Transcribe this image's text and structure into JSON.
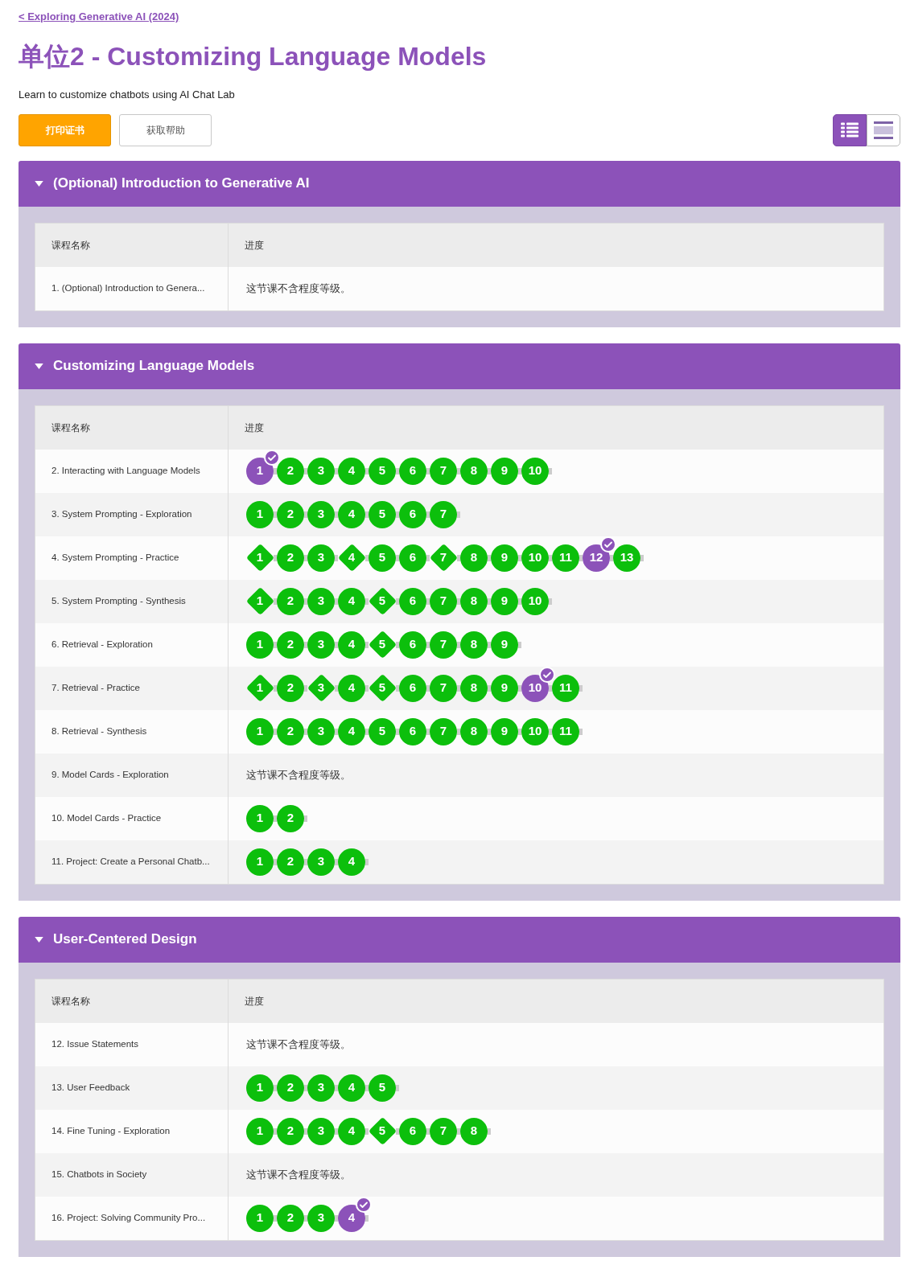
{
  "back_link": "< Exploring Generative AI (2024)",
  "title": "单位2 - Customizing Language Models",
  "description": "Learn to customize chatbots using AI Chat Lab",
  "buttons": [
    {
      "label": "打印证书",
      "kind": "primary"
    },
    {
      "label": "获取帮助",
      "kind": "secondary"
    }
  ],
  "view_toggle": [
    {
      "kind": "detail",
      "selected": true
    },
    {
      "kind": "summary",
      "selected": false
    }
  ],
  "sections": [
    {
      "title": "(Optional) Introduction to Generative AI",
      "expanded": true,
      "columns": [
        "课程名称",
        "进度"
      ],
      "rows": [
        {
          "name": "1. (Optional) Introduction to Genera...",
          "note": "这节课不含程度等级。"
        }
      ]
    },
    {
      "title": "Customizing Language Models",
      "expanded": true,
      "columns": [
        "课程名称",
        "进度"
      ],
      "rows": [
        {
          "name": "2. Interacting with Language Models",
          "levels": [
            {
              "label": "1",
              "kind": "circle",
              "selected": true
            },
            {
              "label": "2",
              "kind": "circle",
              "selected": false
            },
            {
              "label": "3",
              "kind": "circle",
              "selected": false
            },
            {
              "label": "4",
              "kind": "circle",
              "selected": false
            },
            {
              "label": "5",
              "kind": "circle",
              "selected": false
            },
            {
              "label": "6",
              "kind": "circle",
              "selected": false
            },
            {
              "label": "7",
              "kind": "circle",
              "selected": false
            },
            {
              "label": "8",
              "kind": "circle",
              "selected": false
            },
            {
              "label": "9",
              "kind": "circle",
              "selected": false
            },
            {
              "label": "10",
              "kind": "circle",
              "selected": false
            }
          ]
        },
        {
          "name": "3. System Prompting - Exploration",
          "levels": [
            {
              "label": "1",
              "kind": "circle",
              "selected": false
            },
            {
              "label": "2",
              "kind": "circle",
              "selected": false
            },
            {
              "label": "3",
              "kind": "circle",
              "selected": false
            },
            {
              "label": "4",
              "kind": "circle",
              "selected": false
            },
            {
              "label": "5",
              "kind": "circle",
              "selected": false
            },
            {
              "label": "6",
              "kind": "circle",
              "selected": false
            },
            {
              "label": "7",
              "kind": "circle",
              "selected": false
            }
          ]
        },
        {
          "name": "4. System Prompting - Practice",
          "levels": [
            {
              "label": "1",
              "kind": "diamond",
              "selected": false
            },
            {
              "label": "2",
              "kind": "circle",
              "selected": false
            },
            {
              "label": "3",
              "kind": "circle",
              "selected": false
            },
            {
              "label": "4",
              "kind": "diamond",
              "selected": false
            },
            {
              "label": "5",
              "kind": "circle",
              "selected": false
            },
            {
              "label": "6",
              "kind": "circle",
              "selected": false
            },
            {
              "label": "7",
              "kind": "diamond",
              "selected": false
            },
            {
              "label": "8",
              "kind": "circle",
              "selected": false
            },
            {
              "label": "9",
              "kind": "circle",
              "selected": false
            },
            {
              "label": "10",
              "kind": "circle",
              "selected": false
            },
            {
              "label": "11",
              "kind": "circle",
              "selected": false
            },
            {
              "label": "12",
              "kind": "circle",
              "selected": true
            },
            {
              "label": "13",
              "kind": "circle",
              "selected": false
            }
          ]
        },
        {
          "name": "5. System Prompting - Synthesis",
          "levels": [
            {
              "label": "1",
              "kind": "diamond",
              "selected": false
            },
            {
              "label": "2",
              "kind": "circle",
              "selected": false
            },
            {
              "label": "3",
              "kind": "circle",
              "selected": false
            },
            {
              "label": "4",
              "kind": "circle",
              "selected": false
            },
            {
              "label": "5",
              "kind": "diamond",
              "selected": false
            },
            {
              "label": "6",
              "kind": "circle",
              "selected": false
            },
            {
              "label": "7",
              "kind": "circle",
              "selected": false
            },
            {
              "label": "8",
              "kind": "circle",
              "selected": false
            },
            {
              "label": "9",
              "kind": "circle",
              "selected": false
            },
            {
              "label": "10",
              "kind": "circle",
              "selected": false
            }
          ]
        },
        {
          "name": "6. Retrieval - Exploration",
          "levels": [
            {
              "label": "1",
              "kind": "circle",
              "selected": false
            },
            {
              "label": "2",
              "kind": "circle",
              "selected": false
            },
            {
              "label": "3",
              "kind": "circle",
              "selected": false
            },
            {
              "label": "4",
              "kind": "circle",
              "selected": false
            },
            {
              "label": "5",
              "kind": "diamond",
              "selected": false
            },
            {
              "label": "6",
              "kind": "circle",
              "selected": false
            },
            {
              "label": "7",
              "kind": "circle",
              "selected": false
            },
            {
              "label": "8",
              "kind": "circle",
              "selected": false
            },
            {
              "label": "9",
              "kind": "circle",
              "selected": false
            }
          ]
        },
        {
          "name": "7. Retrieval - Practice",
          "levels": [
            {
              "label": "1",
              "kind": "diamond",
              "selected": false
            },
            {
              "label": "2",
              "kind": "circle",
              "selected": false
            },
            {
              "label": "3",
              "kind": "diamond",
              "selected": false
            },
            {
              "label": "4",
              "kind": "circle",
              "selected": false
            },
            {
              "label": "5",
              "kind": "diamond",
              "selected": false
            },
            {
              "label": "6",
              "kind": "circle",
              "selected": false
            },
            {
              "label": "7",
              "kind": "circle",
              "selected": false
            },
            {
              "label": "8",
              "kind": "circle",
              "selected": false
            },
            {
              "label": "9",
              "kind": "circle",
              "selected": false
            },
            {
              "label": "10",
              "kind": "circle",
              "selected": true
            },
            {
              "label": "11",
              "kind": "circle",
              "selected": false
            }
          ]
        },
        {
          "name": "8. Retrieval - Synthesis",
          "levels": [
            {
              "label": "1",
              "kind": "circle",
              "selected": false
            },
            {
              "label": "2",
              "kind": "circle",
              "selected": false
            },
            {
              "label": "3",
              "kind": "circle",
              "selected": false
            },
            {
              "label": "4",
              "kind": "circle",
              "selected": false
            },
            {
              "label": "5",
              "kind": "circle",
              "selected": false
            },
            {
              "label": "6",
              "kind": "circle",
              "selected": false
            },
            {
              "label": "7",
              "kind": "circle",
              "selected": false
            },
            {
              "label": "8",
              "kind": "circle",
              "selected": false
            },
            {
              "label": "9",
              "kind": "circle",
              "selected": false
            },
            {
              "label": "10",
              "kind": "circle",
              "selected": false
            },
            {
              "label": "11",
              "kind": "circle",
              "selected": false
            }
          ]
        },
        {
          "name": "9. Model Cards - Exploration",
          "note": "这节课不含程度等级。"
        },
        {
          "name": "10. Model Cards - Practice",
          "levels": [
            {
              "label": "1",
              "kind": "circle",
              "selected": false
            },
            {
              "label": "2",
              "kind": "circle",
              "selected": false
            }
          ]
        },
        {
          "name": "11. Project: Create a Personal Chatb...",
          "levels": [
            {
              "label": "1",
              "kind": "circle",
              "selected": false
            },
            {
              "label": "2",
              "kind": "circle",
              "selected": false
            },
            {
              "label": "3",
              "kind": "circle",
              "selected": false
            },
            {
              "label": "4",
              "kind": "circle",
              "selected": false
            }
          ]
        }
      ]
    },
    {
      "title": "User-Centered Design",
      "expanded": true,
      "columns": [
        "课程名称",
        "进度"
      ],
      "rows": [
        {
          "name": "12. Issue Statements",
          "note": "这节课不含程度等级。"
        },
        {
          "name": "13. User Feedback",
          "levels": [
            {
              "label": "1",
              "kind": "circle",
              "selected": false
            },
            {
              "label": "2",
              "kind": "circle",
              "selected": false
            },
            {
              "label": "3",
              "kind": "circle",
              "selected": false
            },
            {
              "label": "4",
              "kind": "circle",
              "selected": false
            },
            {
              "label": "5",
              "kind": "circle",
              "selected": false
            }
          ]
        },
        {
          "name": "14. Fine Tuning - Exploration",
          "levels": [
            {
              "label": "1",
              "kind": "circle",
              "selected": false
            },
            {
              "label": "2",
              "kind": "circle",
              "selected": false
            },
            {
              "label": "3",
              "kind": "circle",
              "selected": false
            },
            {
              "label": "4",
              "kind": "circle",
              "selected": false
            },
            {
              "label": "5",
              "kind": "diamond",
              "selected": false
            },
            {
              "label": "6",
              "kind": "circle",
              "selected": false
            },
            {
              "label": "7",
              "kind": "circle",
              "selected": false
            },
            {
              "label": "8",
              "kind": "circle",
              "selected": false
            }
          ]
        },
        {
          "name": "15. Chatbots in Society",
          "note": "这节课不含程度等级。"
        },
        {
          "name": "16. Project: Solving Community Pro...",
          "levels": [
            {
              "label": "1",
              "kind": "circle",
              "selected": false
            },
            {
              "label": "2",
              "kind": "circle",
              "selected": false
            },
            {
              "label": "3",
              "kind": "circle",
              "selected": false
            },
            {
              "label": "4",
              "kind": "circle",
              "selected": true
            }
          ]
        }
      ]
    }
  ]
}
